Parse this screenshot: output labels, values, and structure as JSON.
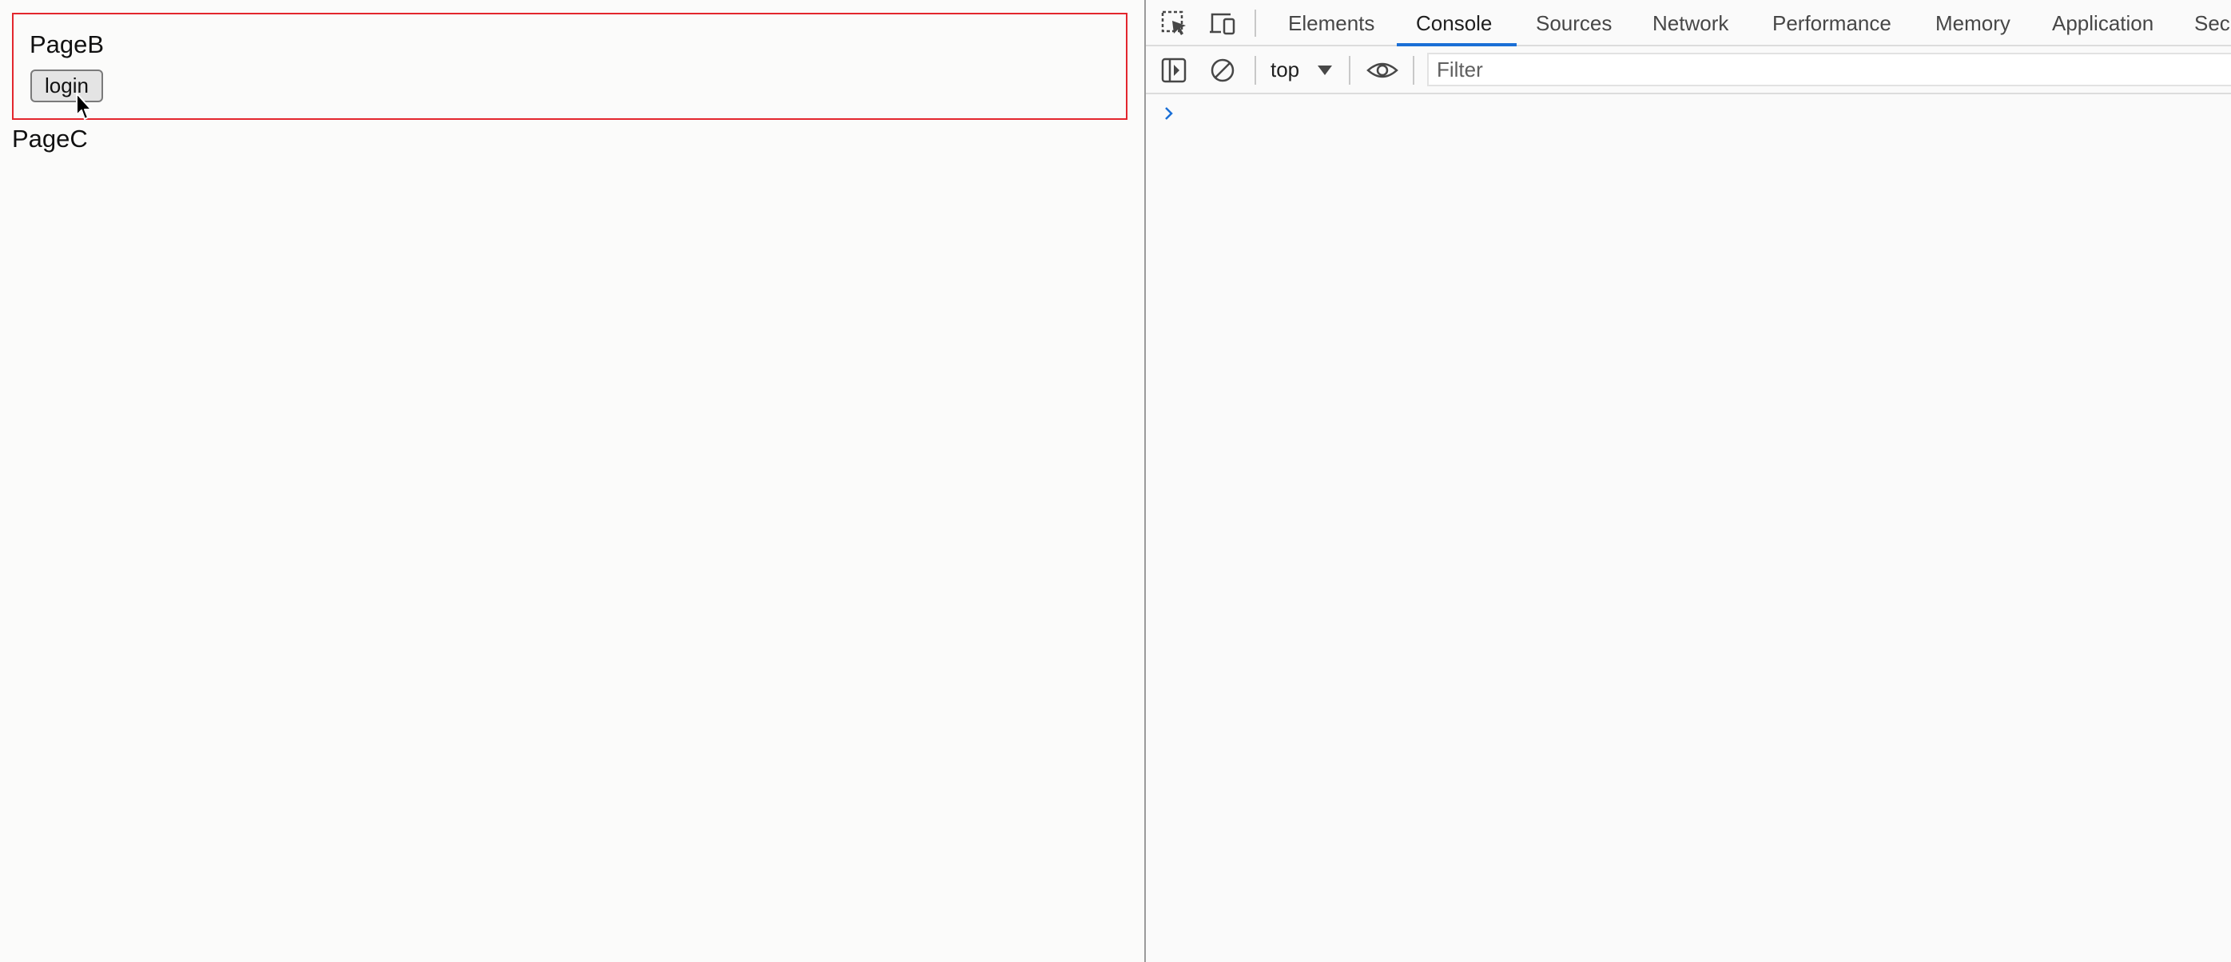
{
  "page": {
    "page_b_title": "PageB",
    "login_label": "login",
    "page_c_title": "PageC"
  },
  "devtools": {
    "tabs": [
      {
        "label": "Elements",
        "active": false
      },
      {
        "label": "Console",
        "active": true
      },
      {
        "label": "Sources",
        "active": false
      },
      {
        "label": "Network",
        "active": false
      },
      {
        "label": "Performance",
        "active": false
      },
      {
        "label": "Memory",
        "active": false
      },
      {
        "label": "Application",
        "active": false
      },
      {
        "label": "Sec",
        "active": false
      }
    ],
    "icons": {
      "inspect": "inspect-element-icon",
      "device": "device-toolbar-icon",
      "sidebar": "sidebar-toggle-icon",
      "clear": "clear-console-icon",
      "eye": "live-expression-eye-icon",
      "prompt": "chevron-right-icon"
    },
    "toolbar": {
      "context": "top",
      "filter_placeholder": "Filter"
    }
  },
  "colors": {
    "accent": "#1a6fd6",
    "frame_border": "#e3262d"
  }
}
